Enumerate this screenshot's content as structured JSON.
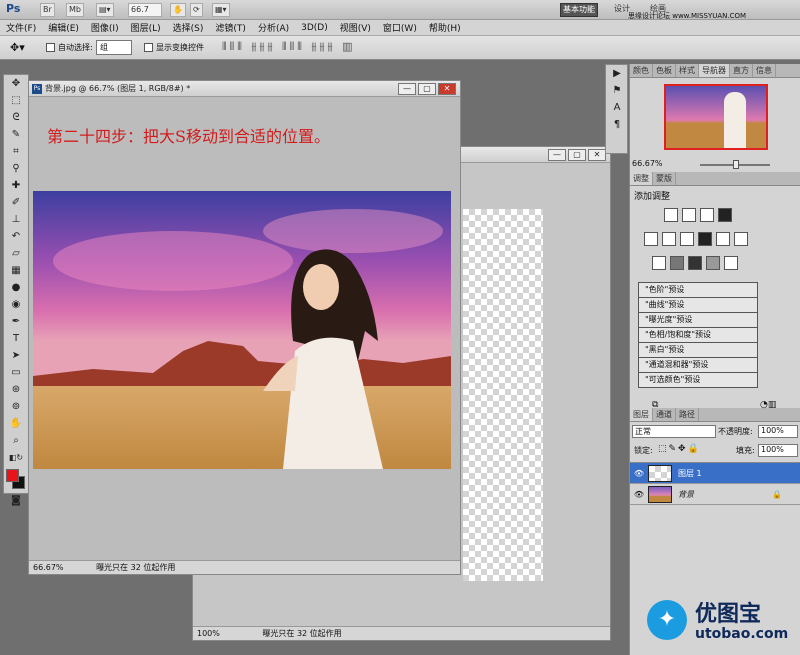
{
  "appbar": {
    "ps_logo": "Ps",
    "zoom": "66.7",
    "workspace_button": "基本功能",
    "workspace_design": "设计",
    "workspace_paint": "绘画"
  },
  "watermark_top": "思缘设计论坛 www.MISSYUAN.COM",
  "menus": [
    "文件(F)",
    "编辑(E)",
    "图像(I)",
    "图层(L)",
    "选择(S)",
    "滤镜(T)",
    "分析(A)",
    "3D(D)",
    "视图(V)",
    "窗口(W)",
    "帮助(H)"
  ],
  "options": {
    "auto_select_label": "自动选择:",
    "auto_select_value": "组",
    "show_transform": "显示变换控件"
  },
  "doc_front": {
    "title": "背景.jpg @ 66.7% (图层 1, RGB/8#) *",
    "caption": "第二十四步：把大S移动到合适的位置。",
    "zoom": "66.67%",
    "status": "曝光只在 32 位起作用"
  },
  "doc_back": {
    "zoom": "100%",
    "status": "曝光只在 32 位起作用"
  },
  "navigator": {
    "tabs": [
      "颜色",
      "色板",
      "样式",
      "导航器",
      "直方",
      "信息"
    ],
    "zoom": "66.67%"
  },
  "adjust": {
    "tabs": [
      "调整",
      "蒙版"
    ],
    "heading": "添加调整",
    "presets": [
      "\"色阶\"预设",
      "\"曲线\"预设",
      "\"曝光度\"预设",
      "\"色相/饱和度\"预设",
      "\"黑白\"预设",
      "\"通道混和器\"预设",
      "\"可选颜色\"预设"
    ]
  },
  "layers": {
    "tabs": [
      "图层",
      "通道",
      "路径"
    ],
    "blend": "正常",
    "opacity_label": "不透明度:",
    "opacity": "100%",
    "lock_label": "锁定:",
    "fill_label": "填充:",
    "fill": "100%",
    "rows": [
      {
        "name": "图层 1"
      },
      {
        "name": "背景"
      }
    ]
  },
  "brand": {
    "name": "优图宝",
    "url": "utobao.com"
  },
  "colors": {
    "foreground": "#e8141c",
    "background": "#111111",
    "layer_selected": "#3a6fc8"
  }
}
